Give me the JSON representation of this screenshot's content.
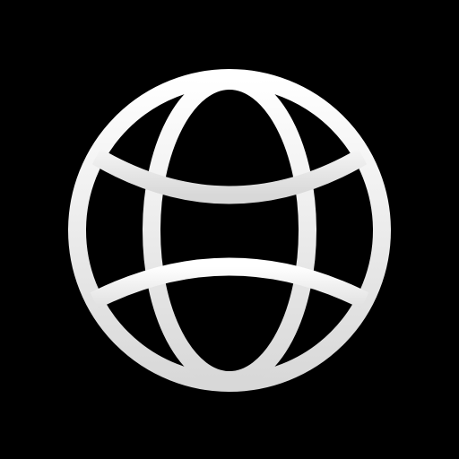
{
  "icon": {
    "name": "globe-icon",
    "background_color": "#000000",
    "foreground_color_light": "#ffffff",
    "foreground_color_shade": "#d8d8d8"
  }
}
